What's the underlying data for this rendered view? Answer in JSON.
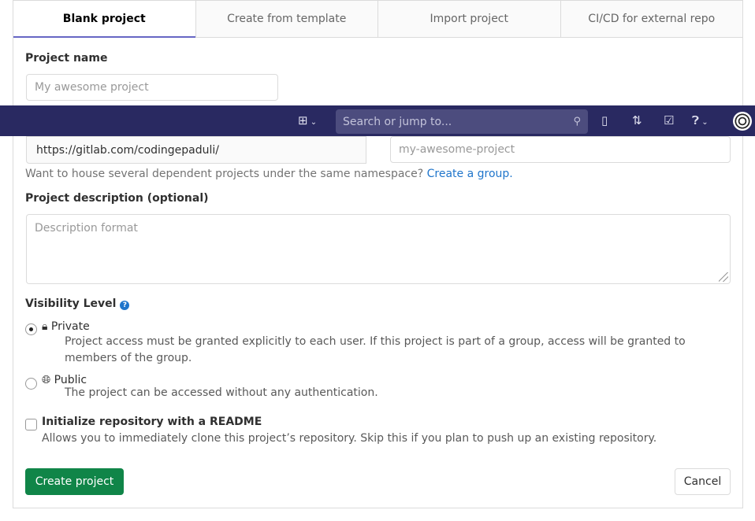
{
  "tabs": [
    {
      "label": "Blank project",
      "active": true
    },
    {
      "label": "Create from template"
    },
    {
      "label": "Import project"
    },
    {
      "label": "CI/CD for external repo"
    }
  ],
  "form": {
    "project_name_label": "Project name",
    "project_name_placeholder": "My awesome project",
    "namespace_url": "https://gitlab.com/codingepaduli/",
    "slug_placeholder": "my-awesome-project",
    "group_hint": "Want to house several dependent projects under the same namespace?",
    "group_link": "Create a group.",
    "description_label": "Project description (optional)",
    "description_placeholder": "Description format",
    "visibility_label": "Visibility Level",
    "visibility_options": [
      {
        "label": "Private",
        "icon": "lock-icon",
        "selected": true,
        "help": "Project access must be granted explicitly to each user. If this project is part of a group, access will be granted to members of the group."
      },
      {
        "label": "Public",
        "icon": "globe-icon",
        "selected": false,
        "help": "The project can be accessed without any authentication."
      }
    ],
    "readme_label": "Initialize repository with a README",
    "readme_checked": false,
    "readme_help": "Allows you to immediately clone this project’s repository. Skip this if you plan to push up an existing repository.",
    "create_button": "Create project",
    "cancel_button": "Cancel"
  },
  "navbar": {
    "search_placeholder": "Search or jump to...",
    "color": "#292961"
  },
  "colors": {
    "primary_button": "#108548",
    "link": "#1f75cb",
    "tab_active": "#6666c4"
  }
}
